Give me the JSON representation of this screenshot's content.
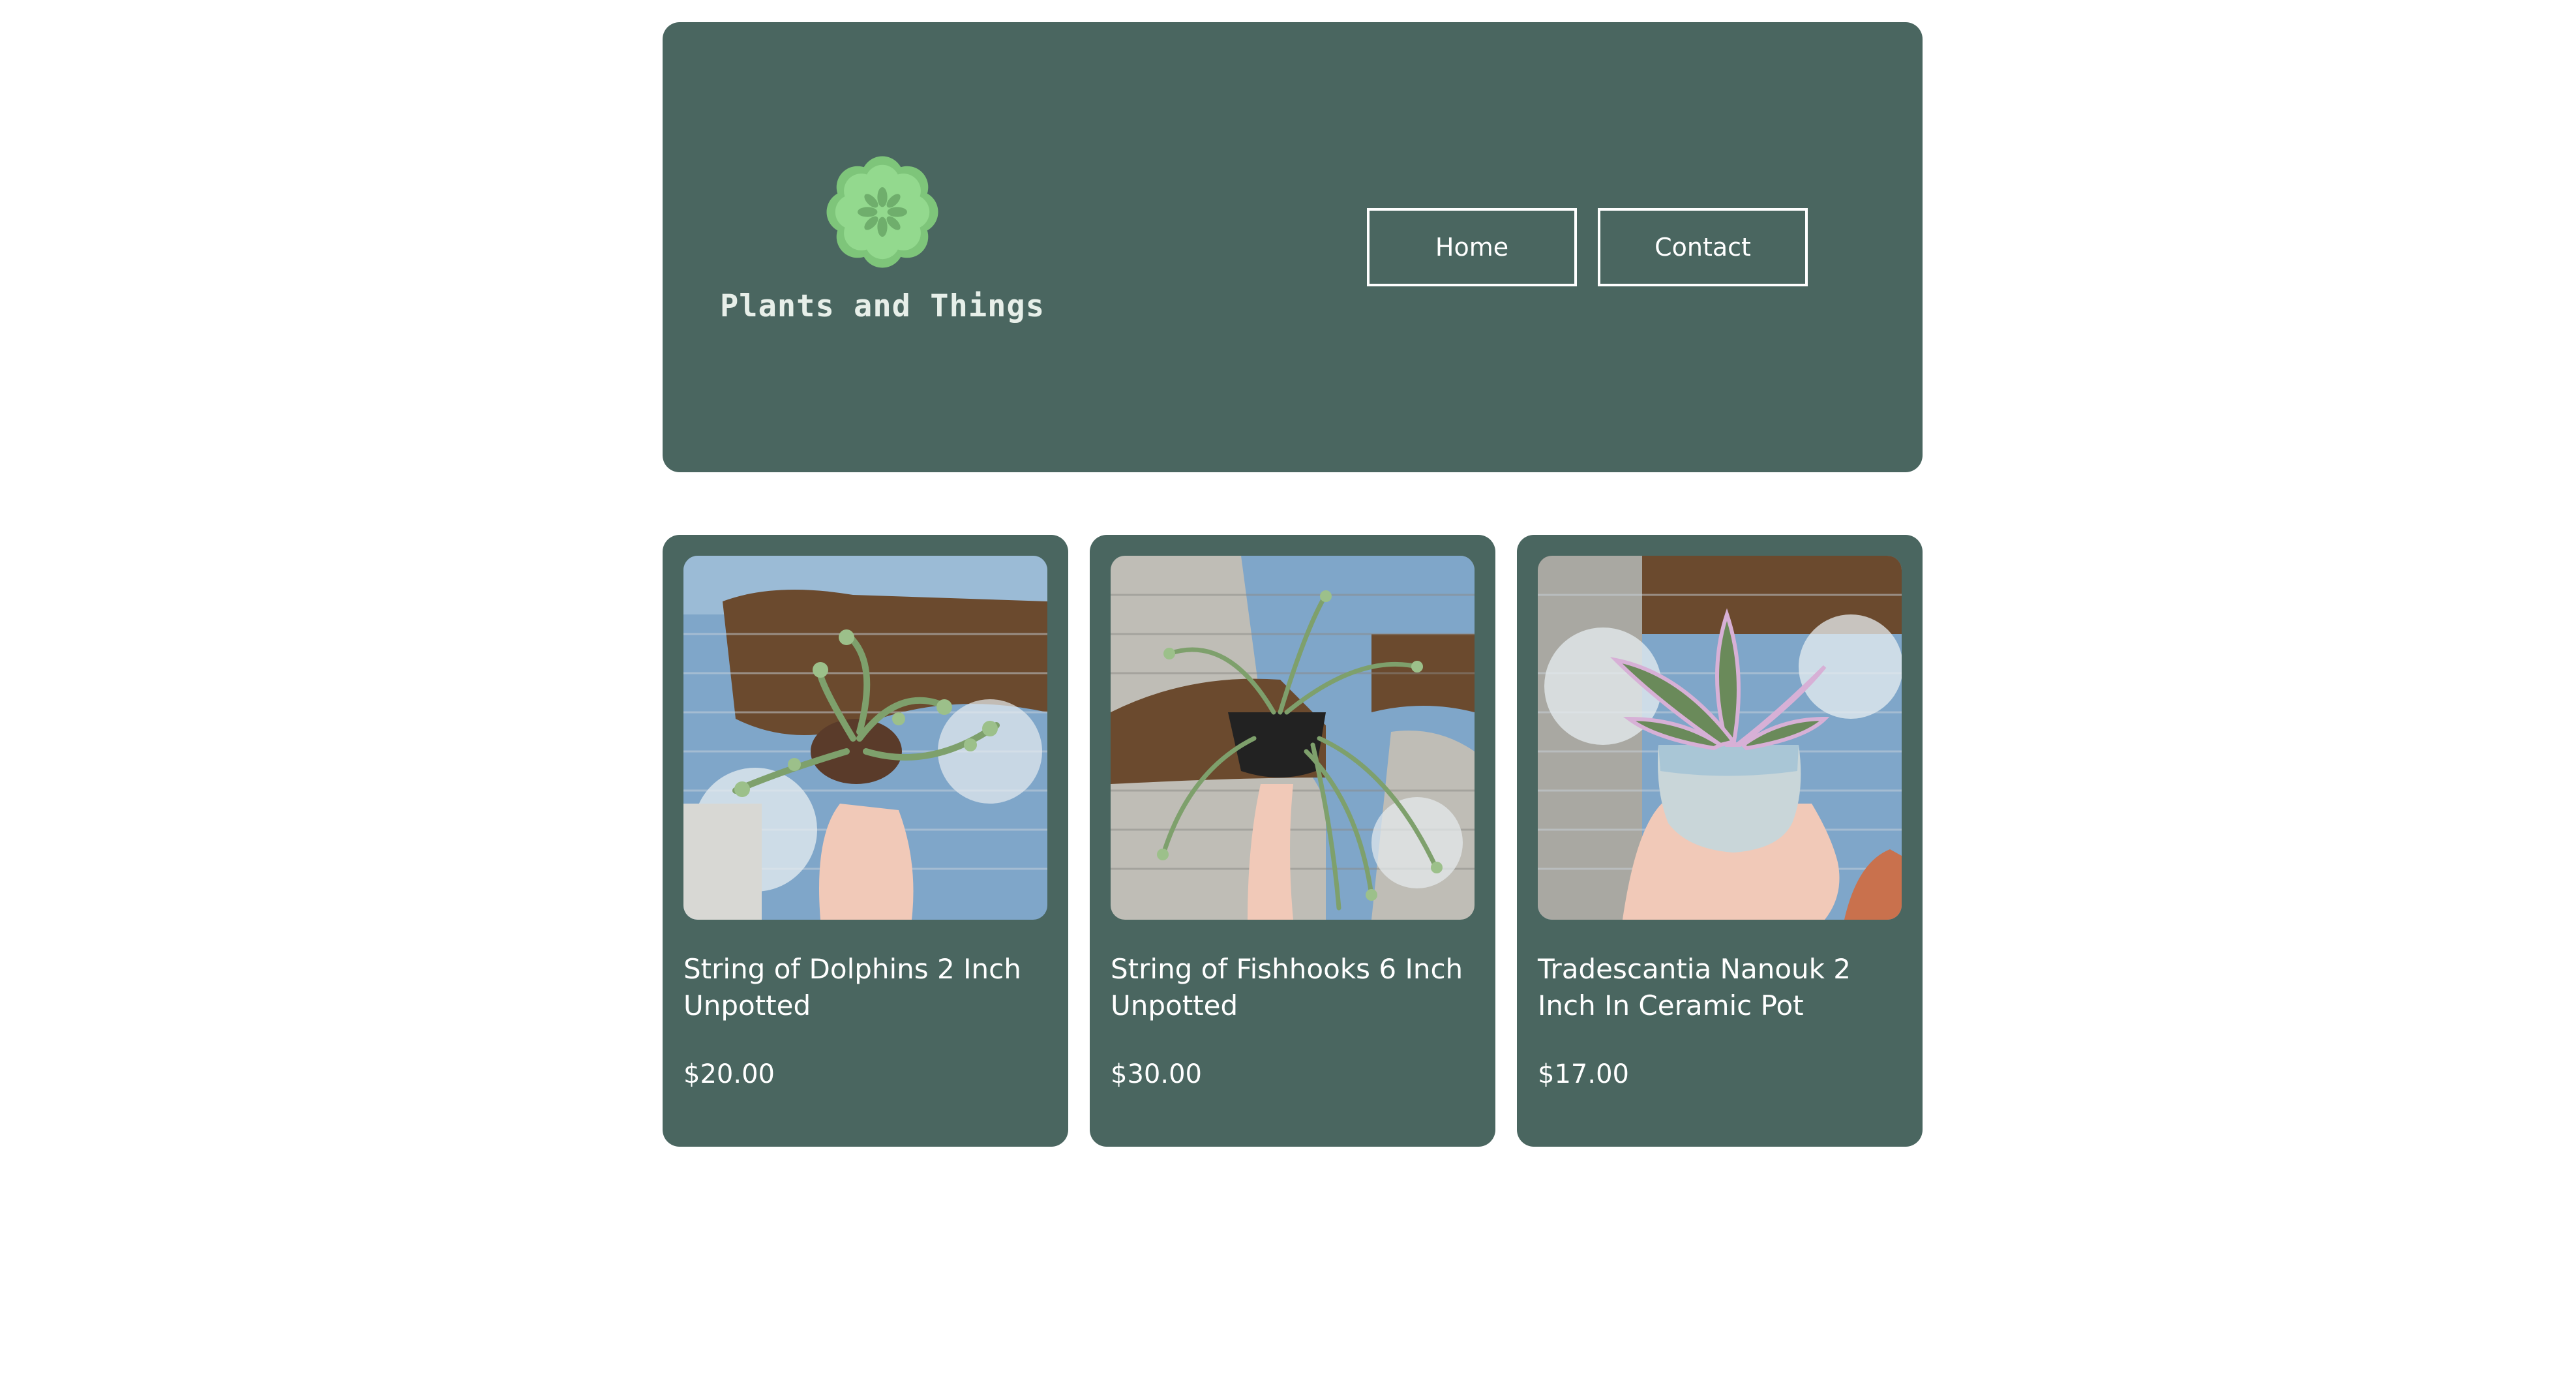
{
  "site": {
    "brand_name": "Plants and Things",
    "logo_icon": "flower-icon",
    "colors": {
      "panel": "#4a6660",
      "logo_outer": "#7ec57a",
      "logo_inner": "#93d98e",
      "logo_center": "#6fae6c",
      "text": "#ffffff"
    }
  },
  "nav": {
    "home_label": "Home",
    "contact_label": "Contact"
  },
  "products": [
    {
      "title": "String of Dolphins 2 Inch Unpotted",
      "price": "$20.00"
    },
    {
      "title": "String of Fishhooks 6 Inch Unpotted",
      "price": "$30.00"
    },
    {
      "title": "Tradescantia Nanouk 2 Inch In Ceramic Pot",
      "price": "$17.00"
    }
  ]
}
